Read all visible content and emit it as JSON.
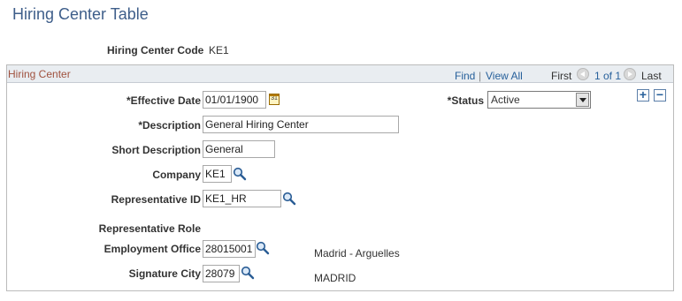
{
  "page": {
    "title": "Hiring Center Table"
  },
  "header": {
    "code_label": "Hiring Center Code",
    "code_value": "KE1"
  },
  "panel": {
    "title": "Hiring Center",
    "nav": {
      "find": "Find",
      "separator": "|",
      "view_all": "View All",
      "first": "First",
      "position": "1 of 1",
      "last": "Last"
    },
    "add_button": "+",
    "delete_button": "−"
  },
  "form": {
    "effective_date": {
      "label": "*Effective Date",
      "value": "01/01/1900",
      "calendar_glyph": "31"
    },
    "status": {
      "label": "*Status",
      "value": "Active"
    },
    "description": {
      "label": "*Description",
      "value": "General Hiring Center"
    },
    "short_description": {
      "label": "Short Description",
      "value": "General"
    },
    "company": {
      "label": "Company",
      "value": "KE1"
    },
    "representative_id": {
      "label": "Representative ID",
      "value": "KE1_HR"
    },
    "representative_role": {
      "label": "Representative Role"
    },
    "employment_office": {
      "label": "Employment Office",
      "value": "28015001",
      "description": "Madrid - Arguelles"
    },
    "signature_city": {
      "label": "Signature City",
      "value": "28079",
      "description": "MADRID"
    }
  },
  "colors": {
    "title": "#3e5e8a",
    "panel_title": "#a0523f",
    "link": "#27609b",
    "panel_header_bg": "#e9edf1"
  },
  "icons": [
    "calendar-icon",
    "lookup-icon",
    "prev-icon",
    "next-icon",
    "add-row-icon",
    "delete-row-icon",
    "dropdown-arrow-icon"
  ]
}
